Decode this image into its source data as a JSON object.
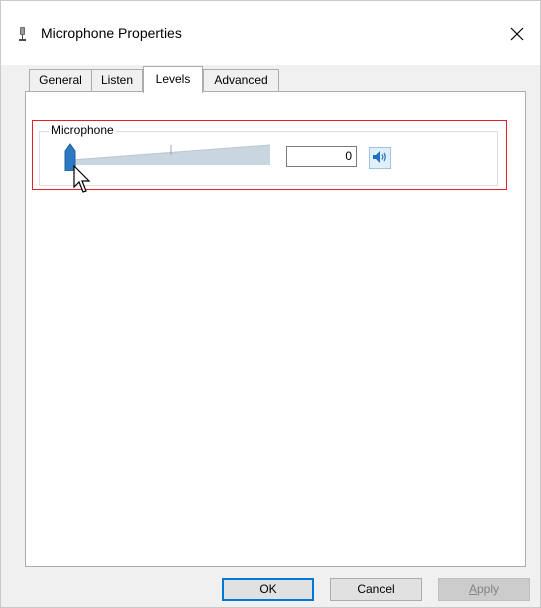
{
  "window": {
    "title": "Microphone Properties",
    "close_symbol": "✕"
  },
  "tabs": [
    {
      "label": "General",
      "active": false
    },
    {
      "label": "Listen",
      "active": false
    },
    {
      "label": "Levels",
      "active": true
    },
    {
      "label": "Advanced",
      "active": false
    }
  ],
  "levels": {
    "group_label": "Microphone",
    "level_value": "0",
    "slider_level_percent": 0,
    "mute_icon": "speaker-icon"
  },
  "buttons": {
    "ok_label": "OK",
    "cancel_label": "Cancel",
    "apply_label_first": "A",
    "apply_label_rest": "pply"
  },
  "colors": {
    "accent": "#0078d7",
    "highlight": "#e0202a",
    "slider_thumb": "#2b79c2",
    "slider_track": "#c9d6e0"
  }
}
